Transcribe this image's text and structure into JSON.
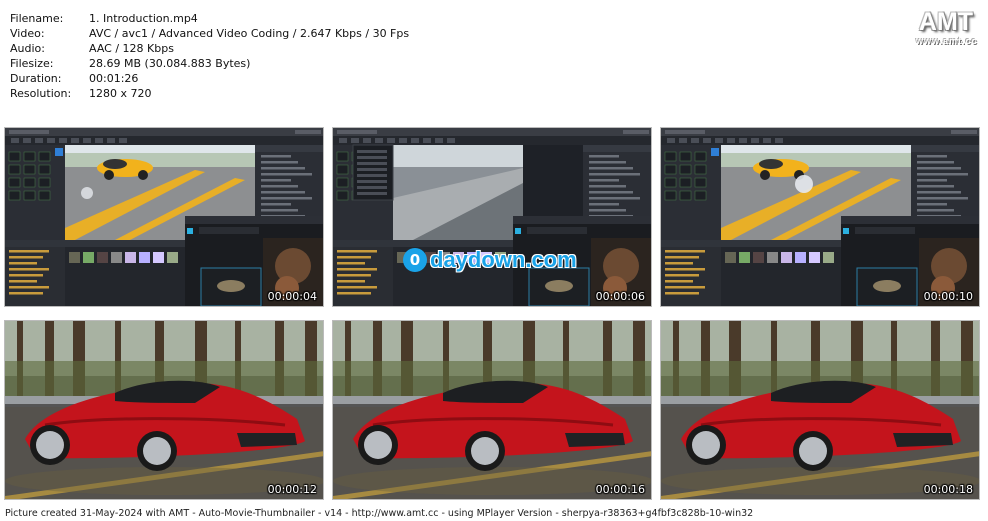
{
  "info": {
    "rows": [
      {
        "key": "Filename:",
        "value": "1. Introduction.mp4"
      },
      {
        "key": "Video:",
        "value": "AVC / avc1 / Advanced Video Coding / 2.647 Kbps / 30 Fps"
      },
      {
        "key": "Audio:",
        "value": "AAC / 128 Kbps"
      },
      {
        "key": "Filesize:",
        "value": "28.69 MB (30.084.883 Bytes)"
      },
      {
        "key": "Duration:",
        "value": "00:01:26"
      },
      {
        "key": "Resolution:",
        "value": "1280 x 720"
      }
    ]
  },
  "logo": {
    "big": "AMT",
    "small": "www.amt.cc"
  },
  "thumbnails": [
    {
      "timestamp": "00:00:04",
      "scene": "editor",
      "variant": "car-road"
    },
    {
      "timestamp": "00:00:06",
      "scene": "editor",
      "variant": "guardrail"
    },
    {
      "timestamp": "00:00:10",
      "scene": "editor",
      "variant": "car-road-sphere"
    },
    {
      "timestamp": "00:00:12",
      "scene": "render"
    },
    {
      "timestamp": "00:00:16",
      "scene": "render"
    },
    {
      "timestamp": "00:00:18",
      "scene": "render"
    }
  ],
  "watermark": {
    "symbol": "0",
    "text": "daydown.com"
  },
  "footer": {
    "text": "Picture created 31-May-2024 with AMT - Auto-Movie-Thumbnailer - v14 - http://www.amt.cc - using MPlayer Version - sherpya-r38363+g4fbf3c828b-10-win32"
  },
  "colors": {
    "editor_bg": "#1e2127",
    "panel": "#2b2e35",
    "accent": "#2f7fd6",
    "car_yellow": "#f2b21c",
    "car_red": "#c4141c",
    "road": "#4b4b4b"
  }
}
